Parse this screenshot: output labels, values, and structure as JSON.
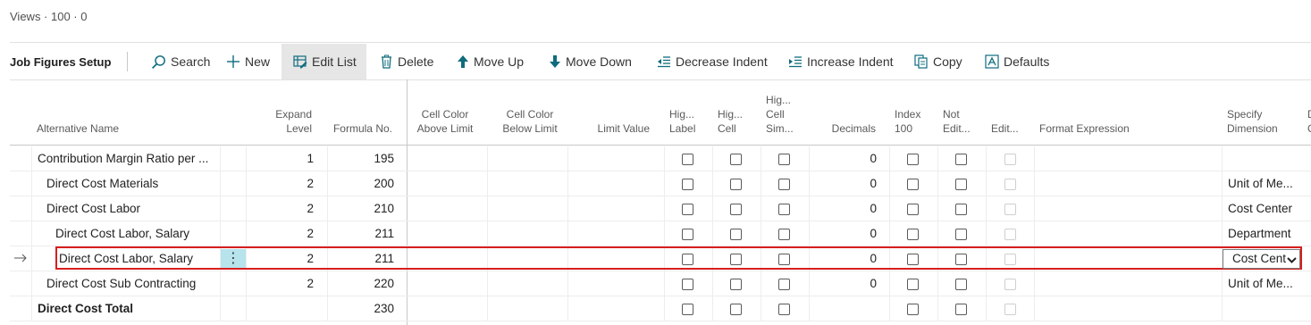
{
  "views_label": "Views · 100 · 0",
  "page_title": "Job Figures Setup",
  "actions": {
    "search": "Search",
    "new": "New",
    "edit_list": "Edit List",
    "delete": "Delete",
    "move_up": "Move Up",
    "move_down": "Move Down",
    "decrease_indent": "Decrease Indent",
    "increase_indent": "Increase Indent",
    "copy": "Copy",
    "defaults": "Defaults"
  },
  "columns": {
    "alt_name": "Alternative Name",
    "expand_1": "Expand",
    "expand_2": "Level",
    "formula": "Formula No.",
    "ccabove_1": "Cell Color",
    "ccabove_2": "Above Limit",
    "ccbelow_1": "Cell Color",
    "ccbelow_2": "Below Limit",
    "limit": "Limit Value",
    "hlabel_1": "Hig...",
    "hlabel_2": "Label",
    "hcell_1": "Hig...",
    "hcell_2": "Cell",
    "hsim_1": "Hig...",
    "hsim_2": "Cell",
    "hsim_3": "Sim...",
    "decimals": "Decimals",
    "index_1": "Index",
    "index_2": "100",
    "notedit_1": "Not",
    "notedit_2": "Edit...",
    "edit": "Edit...",
    "format": "Format Expression",
    "dim_1": "Specify",
    "dim_2": "Dimension",
    "trunc_1": "D",
    "trunc_2": "C"
  },
  "rows": [
    {
      "name": "Contribution Margin Ratio per ...",
      "expand": "1",
      "formula": "195",
      "decimals": "0",
      "dimension": ""
    },
    {
      "name": "Direct Cost Materials",
      "expand": "2",
      "formula": "200",
      "decimals": "0",
      "dimension": "Unit of Me..."
    },
    {
      "name": "Direct Cost Labor",
      "expand": "2",
      "formula": "210",
      "decimals": "0",
      "dimension": "Cost Center"
    },
    {
      "name": "Direct Cost Labor, Salary",
      "expand": "2",
      "formula": "211",
      "decimals": "0",
      "dimension": "Department"
    },
    {
      "name": "Direct Cost Labor, Salary",
      "expand": "2",
      "formula": "211",
      "decimals": "0",
      "dimension": "Cost Cent"
    },
    {
      "name": "Direct Cost Sub Contracting",
      "expand": "2",
      "formula": "220",
      "decimals": "0",
      "dimension": "Unit of Me..."
    },
    {
      "name": "Direct Cost Total",
      "expand": "",
      "formula": "230",
      "decimals": "",
      "dimension": ""
    }
  ],
  "row_menu_glyph": "⋮",
  "selected_row": 4,
  "colors": {
    "accent": "#0f6c7e",
    "selection_border": "#d81e1e",
    "row_menu_bg": "#b6e3ec"
  }
}
